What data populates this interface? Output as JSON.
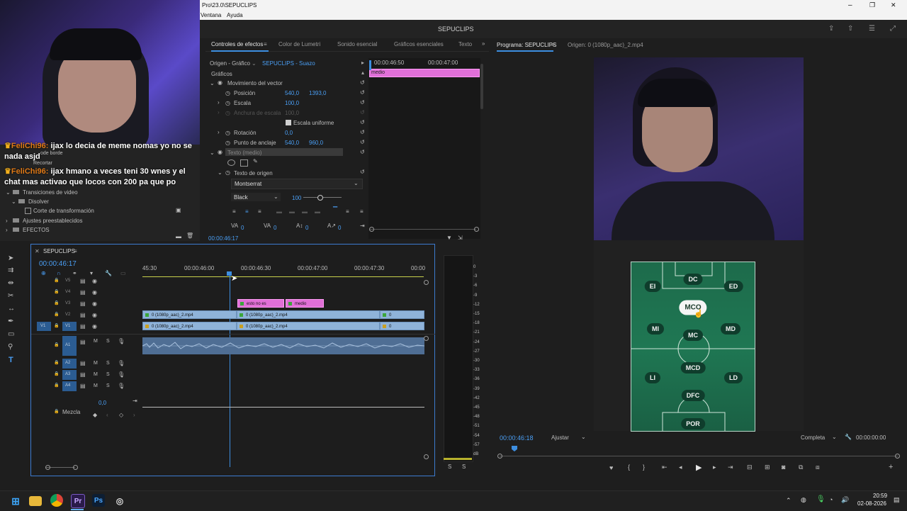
{
  "window": {
    "title": "Pro\\23.0\\SEPUCLIPS",
    "menu": [
      "Ventana",
      "Ayuda"
    ],
    "project_name": "SEPUCLIPS",
    "controls": {
      "minimize": "–",
      "maximize": "❐",
      "close": "✕"
    }
  },
  "chat": {
    "lines": [
      {
        "user": "FeliChi96:",
        "text": " ijax lo decia de meme nomas yo no se nada asjd"
      },
      {
        "user": "FeliChi96:",
        "text": " ijax hmano a veces teni 30 wnes y el chat mas activao que locos con 200 pa que po"
      }
    ]
  },
  "effects_panel": {
    "items": [
      {
        "label": "ode borde",
        "level": 2
      },
      {
        "label": "Recortar",
        "level": 2
      },
      {
        "label": "Transiciones de video",
        "level": 1
      },
      {
        "label": "Disolver",
        "level": 2
      },
      {
        "label": "Corte de transformación",
        "level": 3
      },
      {
        "label": "Ajustes preestablecidos",
        "level": 1
      },
      {
        "label": "EFECTOS",
        "level": 1
      }
    ]
  },
  "effect_controls": {
    "tabs": [
      "Controles de efectos",
      "Color de Lumetri",
      "Sonido esencial",
      "Gráficos esenciales",
      "Texto"
    ],
    "source": "Origen - Gráfico",
    "sequence_clip": "SEPUCLIPS - Suazo",
    "section": "Gráficos",
    "rows": {
      "vector_motion": "Movimiento del vector",
      "position": {
        "label": "Posición",
        "x": "540,0",
        "y": "1393,0"
      },
      "scale": {
        "label": "Escala",
        "value": "100,0"
      },
      "scale_width": {
        "label": "Anchura de escala",
        "value": "100,0"
      },
      "uniform_scale": "Escala uniforme",
      "rotation": {
        "label": "Rotación",
        "value": "0,0"
      },
      "anchor": {
        "label": "Punto de anclaje",
        "x": "540,0",
        "y": "960,0"
      },
      "text_layer": "Texto (medio)",
      "source_text": "Texto de origen",
      "font": "Montserrat",
      "weight": "Black",
      "size": "100",
      "bottom_values": [
        "0",
        "0",
        "0",
        "0"
      ]
    },
    "mini_timeline": {
      "t1": "00:00:46:50",
      "t2": "00:00:47:00",
      "clip": "medio"
    },
    "timecode": "00:00:46:17"
  },
  "timeline": {
    "sequence": "SEPUCLIPS",
    "timecode": "00:00:46:17",
    "ruler": [
      "45:30",
      "00:00:46:00",
      "00:00:46:30",
      "00:00:47:00",
      "00:00:47:30",
      "00:00"
    ],
    "video_tracks": [
      "V5",
      "V4",
      "V3",
      "V2",
      "V1"
    ],
    "audio_tracks": [
      "A1",
      "A2",
      "A3",
      "A4"
    ],
    "source_patch_v": "V1",
    "mix_label": "Mezcla",
    "mix_value": "0,0",
    "clip_names": {
      "video": "0 (1080p_aac)_2.mp4",
      "pink1": "esto no es",
      "pink2": "medio"
    },
    "track_letters": {
      "m": "M",
      "s": "S"
    }
  },
  "meters": {
    "scale": [
      "0",
      "-3",
      "-6",
      "-9",
      "-12",
      "-15",
      "-18",
      "-21",
      "-24",
      "-27",
      "-30",
      "-33",
      "-36",
      "-39",
      "-42",
      "-45",
      "-48",
      "-51",
      "-54",
      "-57",
      "dB"
    ],
    "solo": [
      "S",
      "S"
    ]
  },
  "program": {
    "tab": "Programa: SEPUCLIPS",
    "source_tab": "Origen: 0 (1080p_aac)_2.mp4",
    "timecode": "00:00:46:18",
    "fit": "Ajustar",
    "quality": "Completa",
    "duration": "00:00:00:00",
    "positions": [
      "DC",
      "EI",
      "ED",
      "MCO",
      "MI",
      "MC",
      "MD",
      "MCD",
      "LI",
      "LD",
      "DFC",
      "POR"
    ]
  },
  "taskbar": {
    "time": "20:59",
    "date": "02-08-2026"
  }
}
